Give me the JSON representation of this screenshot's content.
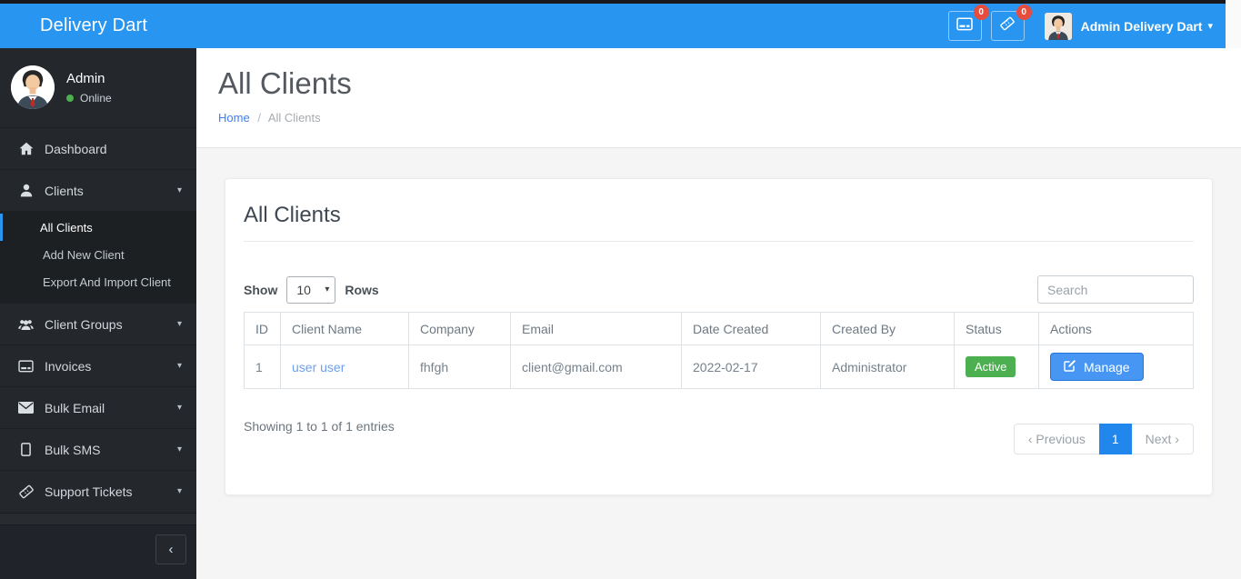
{
  "navbar": {
    "brand": "Delivery Dart",
    "invoices_badge": "0",
    "tickets_badge": "0",
    "user_label": "Admin Delivery Dart",
    "caret": "▾"
  },
  "sidebar": {
    "user": {
      "name": "Admin",
      "status": "Online"
    },
    "menu": [
      {
        "label": "Dashboard",
        "icon": "home-icon"
      },
      {
        "label": "Clients",
        "icon": "user-icon",
        "caret": "▾",
        "submenu": [
          {
            "label": "All Clients",
            "active": true
          },
          {
            "label": "Add New Client"
          },
          {
            "label": "Export And Import Client"
          }
        ]
      },
      {
        "label": "Client Groups",
        "icon": "users-icon",
        "caret": "▾"
      },
      {
        "label": "Invoices",
        "icon": "credit-card-icon",
        "caret": "▾"
      },
      {
        "label": "Bulk Email",
        "icon": "envelope-icon",
        "caret": "▾"
      },
      {
        "label": "Bulk SMS",
        "icon": "mobile-icon",
        "caret": "▾"
      },
      {
        "label": "Support Tickets",
        "icon": "ticket-icon",
        "caret": "▾"
      }
    ],
    "collapse_glyph": "‹"
  },
  "page": {
    "title": "All Clients",
    "breadcrumb": {
      "home": "Home",
      "separator": "/",
      "current": "All Clients"
    }
  },
  "card": {
    "title": "All Clients",
    "show_label": "Show",
    "rows_label": "Rows",
    "rows_value": "10",
    "search_placeholder": "Search",
    "table": {
      "headers": [
        "ID",
        "Client Name",
        "Company",
        "Email",
        "Date Created",
        "Created By",
        "Status",
        "Actions"
      ],
      "rows": [
        {
          "id": "1",
          "client_name": "user user",
          "company": "fhfgh",
          "email": "client@gmail.com",
          "date_created": "2022-02-17",
          "created_by": "Administrator",
          "status": "Active",
          "action": "Manage"
        }
      ]
    },
    "footer": {
      "showing": "Showing 1 to 1 of 1 entries",
      "prev": "‹ Previous",
      "page": "1",
      "next": "Next ›"
    }
  },
  "colors": {
    "navbar_blue": "#2896f0",
    "sidebar_dark": "#24272c",
    "status_green": "#4caf50",
    "button_blue": "#4796f3",
    "badge_red": "#e84c3d",
    "pagination_active_blue": "#2187ec",
    "link_blue": "#6b9ff2"
  }
}
